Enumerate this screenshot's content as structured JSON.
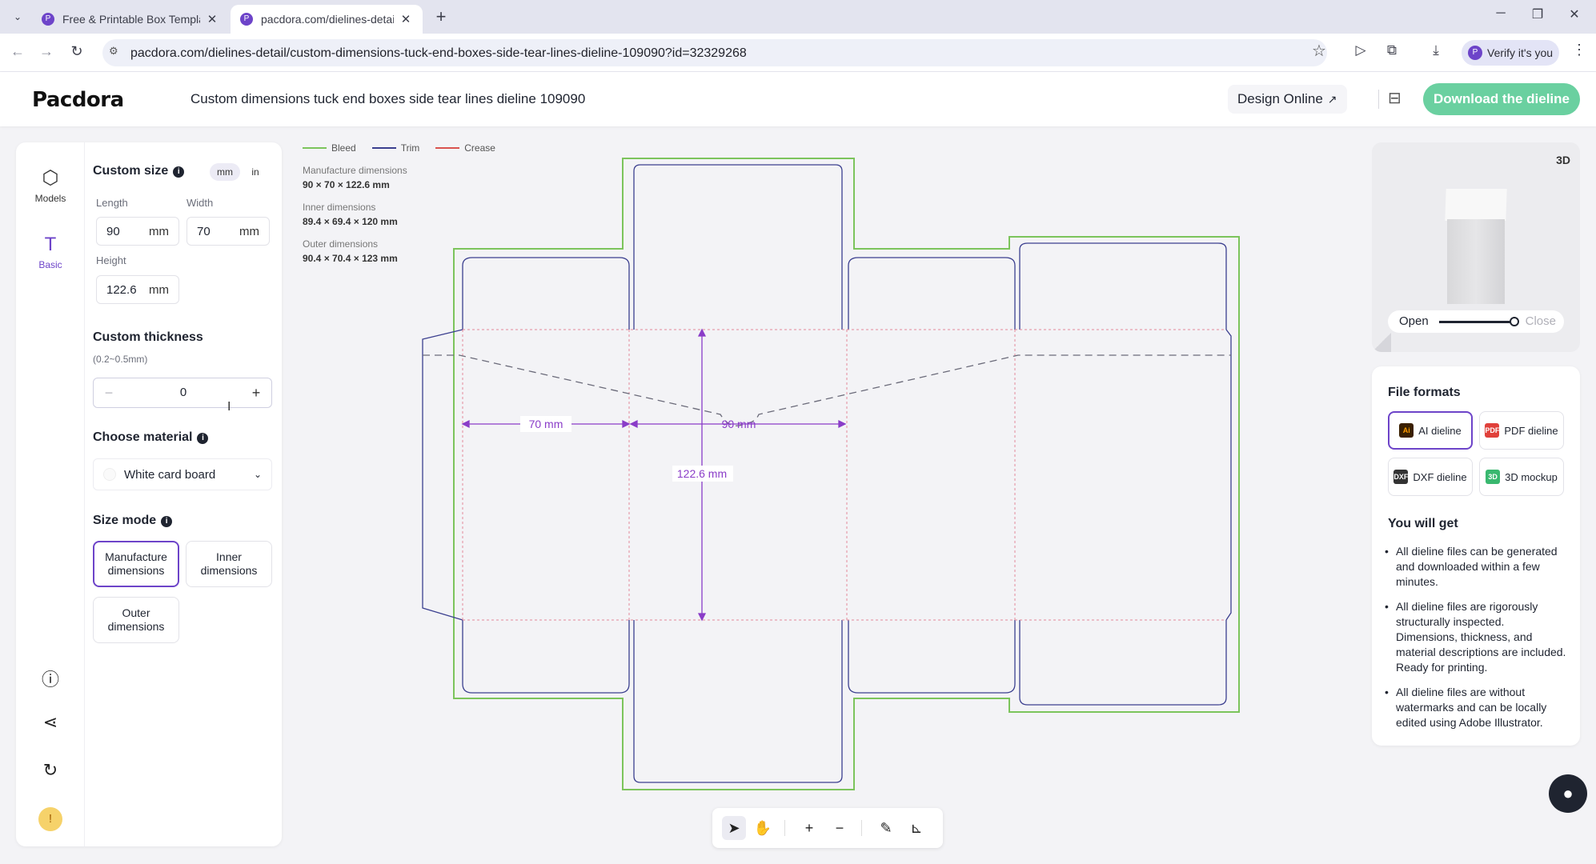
{
  "browser": {
    "tabs": [
      {
        "title": "Free & Printable Box Templat",
        "close": "✕"
      },
      {
        "title": "pacdora.com/dielines-detail/",
        "close": "✕"
      }
    ],
    "new_tab": "+",
    "url": "pacdora.com/dielines-detail/custom-dimensions-tuck-end-boxes-side-tear-lines-dieline-109090?id=32329268",
    "verify": "Verify it's you"
  },
  "header": {
    "logo": "Pacdora",
    "title": "Custom dimensions tuck end boxes side tear lines dieline 109090",
    "design_online": "Design Online",
    "download": "Download the dieline"
  },
  "rail": {
    "models": "Models",
    "basic": "Basic"
  },
  "settings": {
    "custom_size": "Custom size",
    "units": [
      "mm",
      "in"
    ],
    "length_label": "Length",
    "length_value": "90",
    "width_label": "Width",
    "width_value": "70",
    "height_label": "Height",
    "height_value": "122.6",
    "unit": "mm",
    "thickness_title": "Custom thickness",
    "thickness_hint": "(0.2~0.5mm)",
    "thickness_value": "0",
    "minus": "−",
    "plus": "+",
    "material_title": "Choose material",
    "material_value": "White card board",
    "size_mode_title": "Size mode",
    "modes": [
      "Manufacture dimensions",
      "Inner dimensions",
      "Outer dimensions"
    ],
    "selected_mode": "Manufacture dimensions"
  },
  "canvas": {
    "legend": [
      {
        "label": "Bleed",
        "color": "#7cc45c"
      },
      {
        "label": "Trim",
        "color": "#3b3f8f"
      },
      {
        "label": "Crease",
        "color": "#d9534f"
      }
    ],
    "manufacture_label": "Manufacture dimensions",
    "manufacture_value": "90 × 70 × 122.6 mm",
    "inner_label": "Inner dimensions",
    "inner_value": "89.4 × 69.4 × 120 mm",
    "outer_label": "Outer dimensions",
    "outer_value": "90.4 × 70.4 × 123 mm",
    "dim_width": "70 mm",
    "dim_length": "90 mm",
    "dim_height": "122.6 mm",
    "dim_color": "#8a3cc8"
  },
  "preview": {
    "badge": "3D",
    "open": "Open",
    "close": "Close"
  },
  "formats": {
    "title": "File formats",
    "items": [
      {
        "label": "AI dieline",
        "icon": "Ai",
        "color": "#3a1f00"
      },
      {
        "label": "PDF dieline",
        "icon": "PDF",
        "color": "#e0403a"
      },
      {
        "label": "DXF dieline",
        "icon": "DXF",
        "color": "#333333"
      },
      {
        "label": "3D mockup",
        "icon": "3D",
        "color": "#39b86f"
      }
    ],
    "you_will_get": "You will get",
    "benefits": [
      "All dieline files can be generated and downloaded within a few minutes.",
      "All dieline files are rigorously structurally inspected. Dimensions, thickness, and material descriptions are included. Ready for printing.",
      "All dieline files are without watermarks and can be locally edited using Adobe Illustrator."
    ]
  },
  "colors": {
    "accent": "#6d44c9",
    "download": "#6ad0a0"
  }
}
